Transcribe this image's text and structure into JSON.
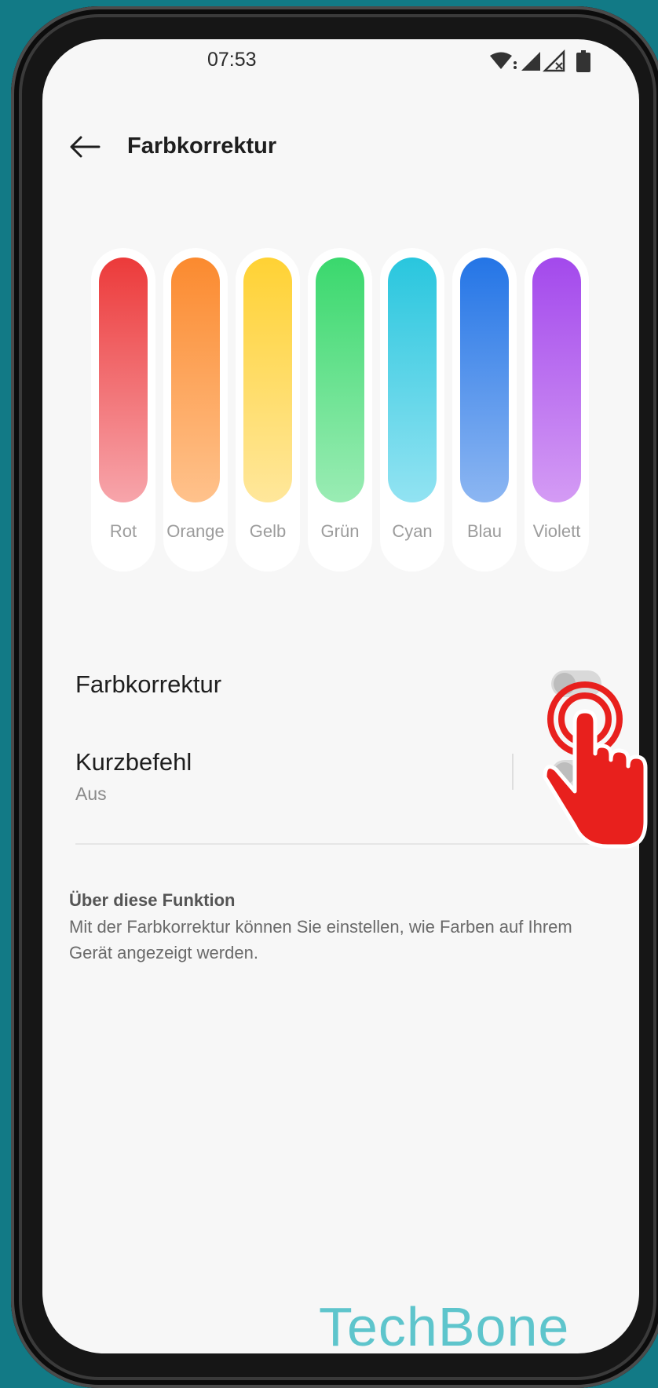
{
  "status_bar": {
    "time": "07:53",
    "icons": [
      "wifi-icon",
      "signal-icon",
      "signal-no-service-icon",
      "battery-icon"
    ]
  },
  "header": {
    "title": "Farbkorrektur",
    "back_icon": "arrow-left-icon"
  },
  "colors": [
    {
      "label": "Rot",
      "top": "#ec3a3a",
      "bottom": "#f7a5ab"
    },
    {
      "label": "Orange",
      "top": "#fb8a2f",
      "bottom": "#ffc28c"
    },
    {
      "label": "Gelb",
      "top": "#ffd234",
      "bottom": "#ffe79b"
    },
    {
      "label": "Grün",
      "top": "#3ad86d",
      "bottom": "#9aecb4"
    },
    {
      "label": "Cyan",
      "top": "#29c6de",
      "bottom": "#92e3f2"
    },
    {
      "label": "Blau",
      "top": "#2475e6",
      "bottom": "#8cb6f2"
    },
    {
      "label": "Violett",
      "top": "#a349ec",
      "bottom": "#d49bf4"
    }
  ],
  "settings": {
    "color_correction": {
      "title": "Farbkorrektur",
      "enabled": false
    },
    "shortcut": {
      "title": "Kurzbefehl",
      "subtitle": "Aus",
      "enabled": false
    }
  },
  "about": {
    "heading": "Über diese Funktion",
    "text": "Mit der Farbkorrektur können Sie einstellen, wie Farben auf Ihrem Gerät angezeigt werden."
  },
  "watermark": "TechBone",
  "overlay": {
    "tap_indicator_color": "#e8201d",
    "icon": "tap-hand-icon"
  }
}
